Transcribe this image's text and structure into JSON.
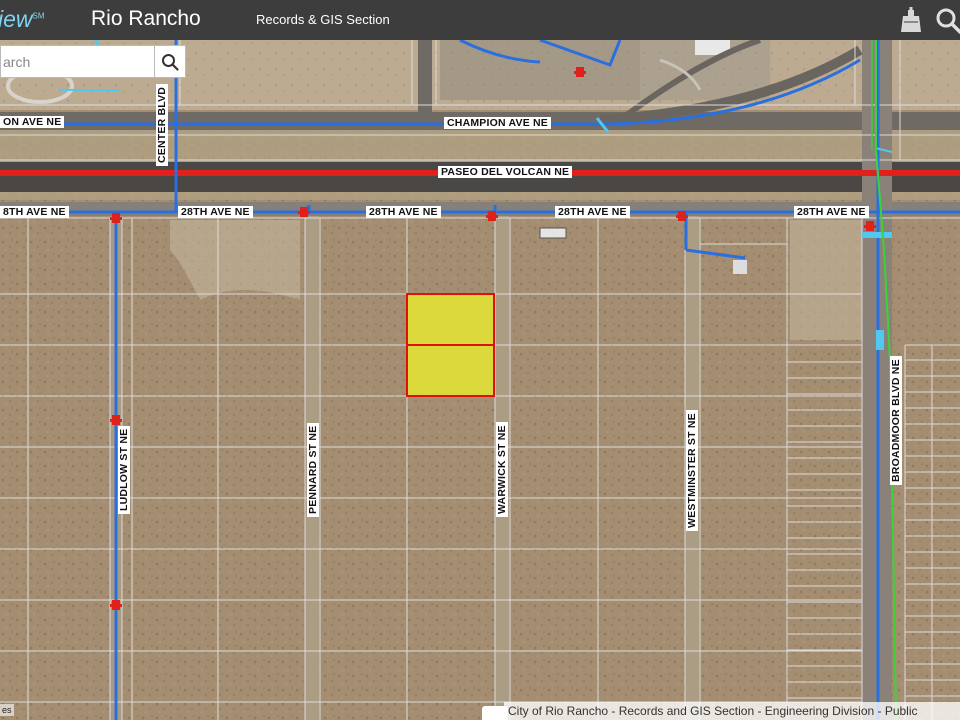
{
  "header": {
    "brand": "iew",
    "brand_mark": "SM",
    "title": "Rio Rancho",
    "subtitle": "Records & GIS Section"
  },
  "icons": {
    "basemap": "basemap-gallery-icon",
    "search": "search-icon",
    "search_button": "search-icon",
    "hydrant": "fire-hydrant-icon"
  },
  "search": {
    "placeholder": "arch"
  },
  "roads": {
    "champion_left": "ON AVE NE",
    "champion": "CHAMPION AVE NE",
    "paseo": "PASEO DEL VOLCAN NE",
    "ave28_1": "8TH AVE NE",
    "ave28_2": "28TH AVE NE",
    "ave28_3": "28TH AVE NE",
    "ave28_4": "28TH AVE NE",
    "ave28_5": "28TH AVE NE",
    "center": "CENTER BLVD",
    "ludlow": "LUDLOW ST NE",
    "pennard": "PENNARD ST NE",
    "warwick": "WARWICK ST NE",
    "westminster": "WESTMINSTER ST NE",
    "broadmoor": "BROADMOOR BLVD NE"
  },
  "footer": {
    "attribution": "City of Rio Rancho - Records and GIS Section - Engineering Division - Public",
    "esri": "es"
  },
  "colors": {
    "header_bg": "#3d3d3d",
    "brand": "#7fd3f0",
    "parcel_selected_fill": "#e6e632",
    "parcel_selected_stroke": "#e01010",
    "water_line": "#2a6fe0",
    "arterial": "#e0201a",
    "trail": "#3cd23c",
    "parcel_line": "#dcdcdc"
  }
}
